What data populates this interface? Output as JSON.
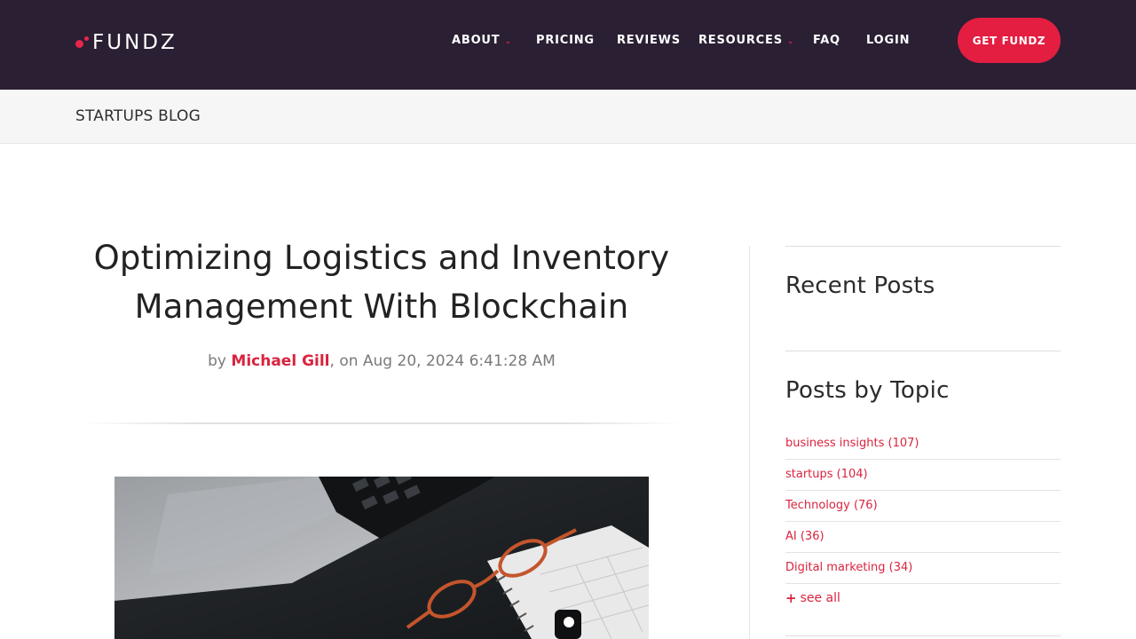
{
  "header": {
    "logo_text": "FUNDZ",
    "nav": [
      {
        "label": "ABOUT",
        "has_dropdown": true
      },
      {
        "label": "PRICING",
        "has_dropdown": false
      },
      {
        "label": "REVIEWS",
        "has_dropdown": false
      },
      {
        "label": "RESOURCES",
        "has_dropdown": true
      },
      {
        "label": "FAQ",
        "has_dropdown": false
      },
      {
        "label": "LOGIN",
        "has_dropdown": false
      }
    ],
    "cta_label": "GET FUNDZ",
    "chevron": "⌄"
  },
  "subbar": {
    "breadcrumb": "STARTUPS BLOG"
  },
  "article": {
    "title_line1": "Optimizing Logistics and Inventory",
    "title_line2": "Management With Blockchain",
    "by_prefix": "by ",
    "author": "Michael Gill",
    "date_text": ", on Aug 20, 2024 6:41:28 AM"
  },
  "sidebar": {
    "recent_heading": "Recent Posts",
    "topics_heading": "Posts by Topic",
    "topics": [
      {
        "label": "business insights (107)"
      },
      {
        "label": "startups (104)"
      },
      {
        "label": "Technology (76)"
      },
      {
        "label": "AI (36)"
      },
      {
        "label": "Digital marketing (34)"
      }
    ],
    "see_all_plus": "+",
    "see_all_label": "see all"
  },
  "colors": {
    "header_bg": "#2a1f33",
    "accent": "#e31e41",
    "link": "#d9243f"
  }
}
